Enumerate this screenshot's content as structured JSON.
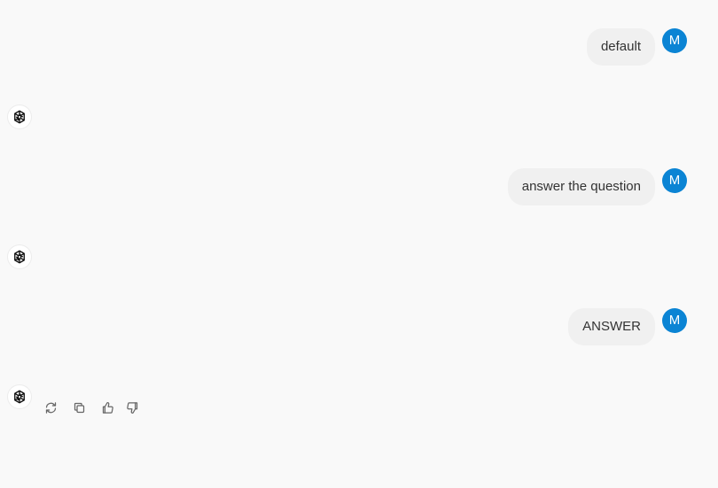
{
  "conversation": {
    "messages": [
      {
        "role": "user",
        "avatar_initial": "M",
        "text": "default"
      },
      {
        "role": "assistant",
        "text": ""
      },
      {
        "role": "user",
        "avatar_initial": "M",
        "text": "answer the question"
      },
      {
        "role": "assistant",
        "text": ""
      },
      {
        "role": "user",
        "avatar_initial": "M",
        "text": "ANSWER"
      },
      {
        "role": "assistant",
        "text": ""
      }
    ]
  },
  "actions": {
    "icons": [
      "regenerate-icon",
      "copy-icon",
      "thumbs-up-icon",
      "thumbs-down-icon"
    ]
  },
  "colors": {
    "background": "#f9f9f9",
    "user_bubble": "#f0f0f0",
    "avatar": "#0b84d4"
  }
}
